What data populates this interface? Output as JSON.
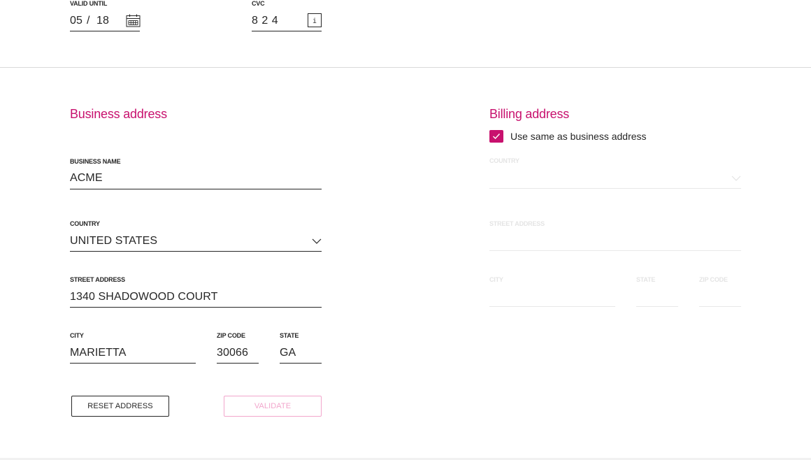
{
  "card": {
    "valid_until_label": "VALID UNTIL",
    "month": "05",
    "separator": "/",
    "year": "18",
    "cvc_label": "CVC",
    "cvc_value": "8 2 4"
  },
  "business": {
    "title": "Business address",
    "name_label": "BUSINESS NAME",
    "name_value": "ACME",
    "country_label": "COUNTRY",
    "country_value": "UNITED STATES",
    "street_label": "STREET ADDRESS",
    "street_value": "1340 SHADOWOOD COURT",
    "city_label": "CITY",
    "city_value": "MARIETTA",
    "zip_label": "ZIP CODE",
    "zip_value": "30066",
    "state_label": "STATE",
    "state_value": "GA"
  },
  "billing": {
    "title": "Billing address",
    "same_as_label": "Use same as business address",
    "same_as_checked": true,
    "country_label": "COUNTRY",
    "street_label": "STREET ADDRESS",
    "city_label": "CITY",
    "state_label": "STATE",
    "zip_label": "ZIP CODE"
  },
  "actions": {
    "reset_label": "RESET ADDRESS",
    "validate_label": "VALIDATE"
  },
  "colors": {
    "accent": "#c8116e",
    "accent_disabled": "#f2a6cc",
    "text": "#262626",
    "disabled": "#e4e4e4"
  },
  "icons": {
    "calendar": "calendar-icon",
    "info": "info-icon",
    "dropdown": "chevron-down-icon",
    "check": "check-icon"
  }
}
